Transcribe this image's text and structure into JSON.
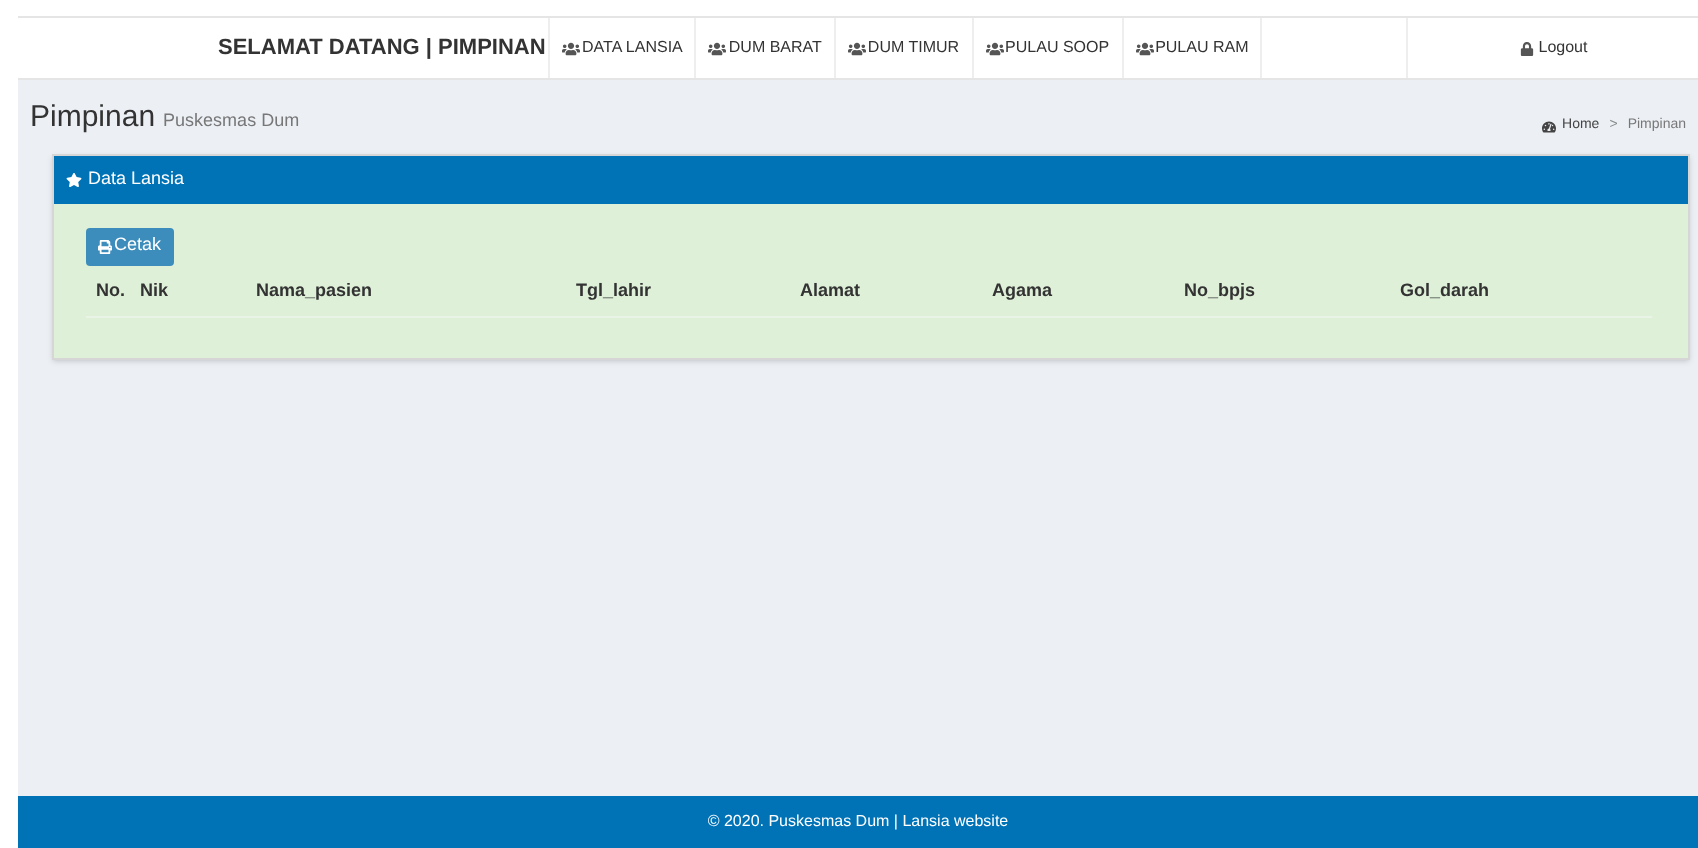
{
  "navbar": {
    "brand": "SELAMAT DATANG | PIMPINAN",
    "items": [
      {
        "label": "DATA LANSIA"
      },
      {
        "label": "DUM BARAT"
      },
      {
        "label": "DUM TIMUR"
      },
      {
        "label": "PULAU SOOP"
      },
      {
        "label": "PULAU RAM"
      }
    ],
    "logout": "Logout"
  },
  "header": {
    "title": "Pimpinan",
    "subtitle": "Puskesmas Dum"
  },
  "breadcrumb": [
    "Home",
    "Pimpinan"
  ],
  "breadcrumb_separator": ">",
  "panel": {
    "title": "Data Lansia",
    "print_button": "Cetak"
  },
  "table": {
    "columns": [
      "No.",
      "Nik",
      "Nama_pasien",
      "Tgl_lahir",
      "Alamat",
      "Agama",
      "No_bpjs",
      "Gol_darah"
    ]
  },
  "footer": "© 2020. Puskesmas Dum | Lansia website"
}
